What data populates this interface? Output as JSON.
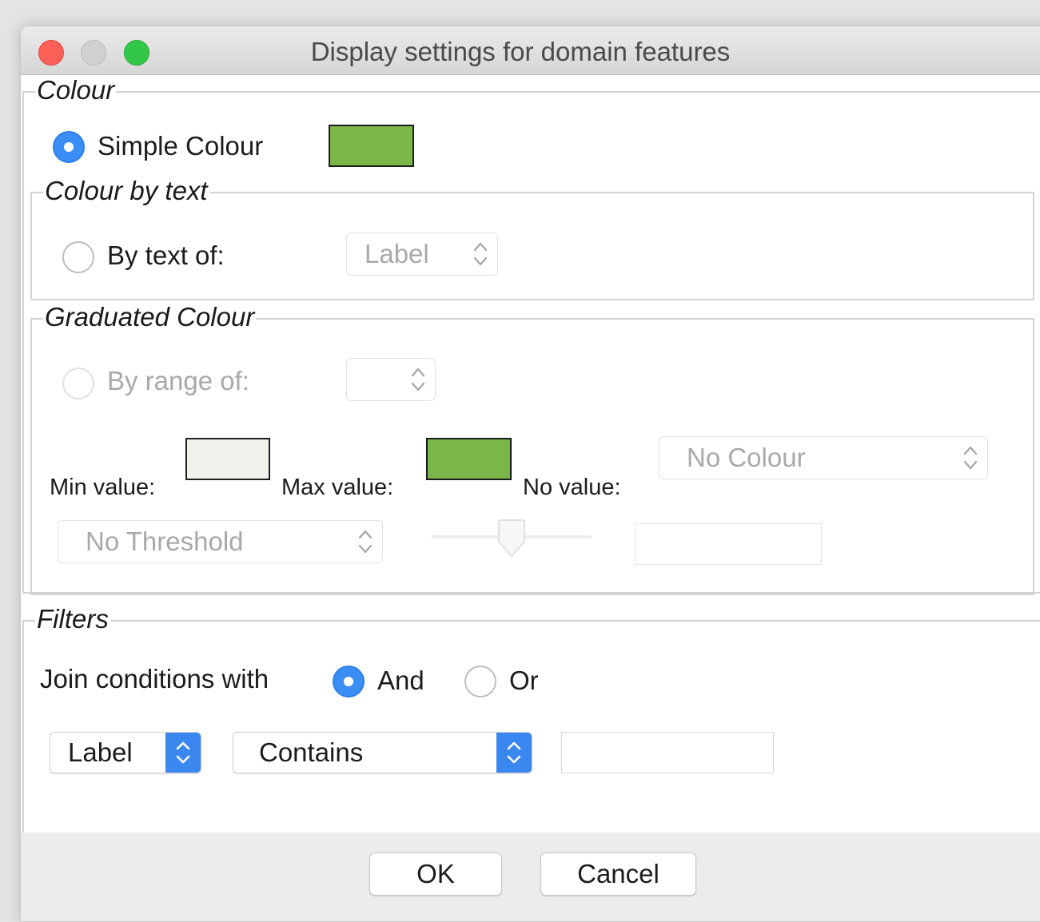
{
  "window": {
    "title": "Display settings for domain features"
  },
  "colour": {
    "legend": "Colour",
    "simple_label": "Simple Colour",
    "simple_selected": true,
    "simple_color": "#7ab648"
  },
  "colour_by_text": {
    "legend": "Colour by text",
    "by_text_label": "By text of:",
    "by_text_selected": false,
    "select_value": "Label"
  },
  "graduated": {
    "legend": "Graduated Colour",
    "by_range_label": "By range of:",
    "by_range_selected": false,
    "range_select_value": "",
    "min_label": "Min value:",
    "min_color": "#f0f2ec",
    "max_label": "Max value:",
    "max_color": "#7ab648",
    "no_value_label": "No value:",
    "no_value_select": "No Colour",
    "threshold_select": "No Threshold",
    "threshold_slider_fraction": 0.5,
    "threshold_value": ""
  },
  "filters": {
    "legend": "Filters",
    "join_label": "Join conditions with",
    "and_label": "And",
    "or_label": "Or",
    "join_selected": "And",
    "attribute_select": "Label",
    "condition_select": "Contains",
    "pattern_value": ""
  },
  "buttons": {
    "ok": "OK",
    "cancel": "Cancel"
  },
  "colors": {
    "accent": "#3a8ef6",
    "disabled_text": "#a9a9a9"
  }
}
